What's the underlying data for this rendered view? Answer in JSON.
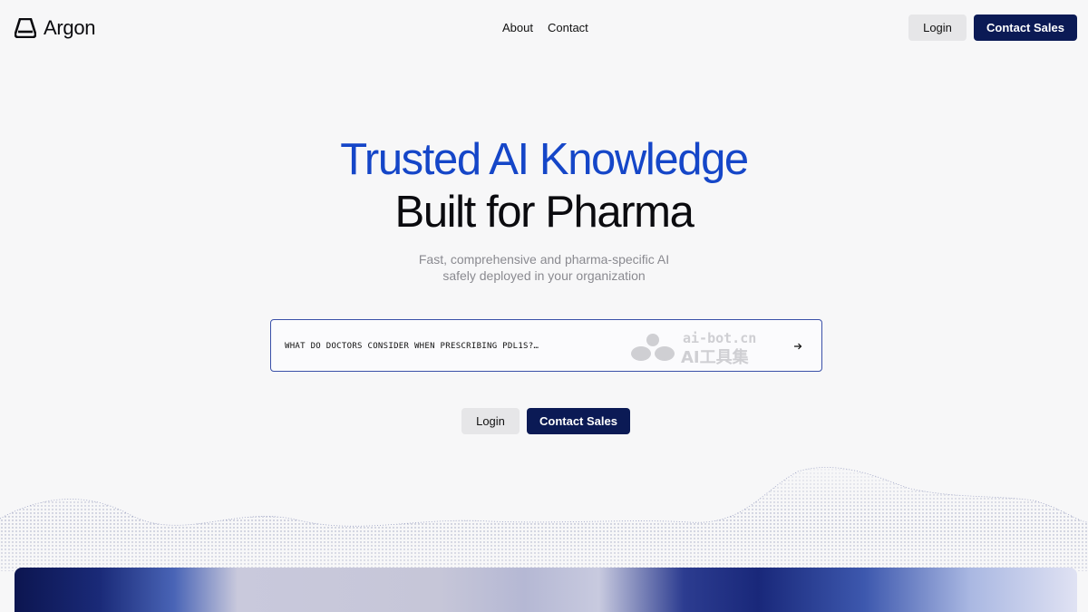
{
  "brand": {
    "name": "Argon"
  },
  "nav": {
    "items": [
      {
        "label": "About"
      },
      {
        "label": "Contact"
      }
    ]
  },
  "header_actions": {
    "login_label": "Login",
    "contact_sales_label": "Contact Sales"
  },
  "hero": {
    "title_line_1": "Trusted AI Knowledge",
    "title_line_2": "Built for Pharma",
    "subtitle_line_1": "Fast, comprehensive and pharma-specific AI",
    "subtitle_line_2": "safely deployed in your organization"
  },
  "search": {
    "placeholder": "WHAT DO DOCTORS CONSIDER WHEN PRESCRIBING PDL1S?…",
    "submit_icon": "arrow-right-icon"
  },
  "watermark": {
    "line_1": "ai-bot.cn",
    "line_2": "AI工具集"
  },
  "cta": {
    "login_label": "Login",
    "contact_sales_label": "Contact Sales"
  },
  "colors": {
    "accent_blue": "#1546c8",
    "navy": "#0b1a55",
    "background": "#f7f7f8",
    "subtitle_gray": "#8a8a90"
  }
}
